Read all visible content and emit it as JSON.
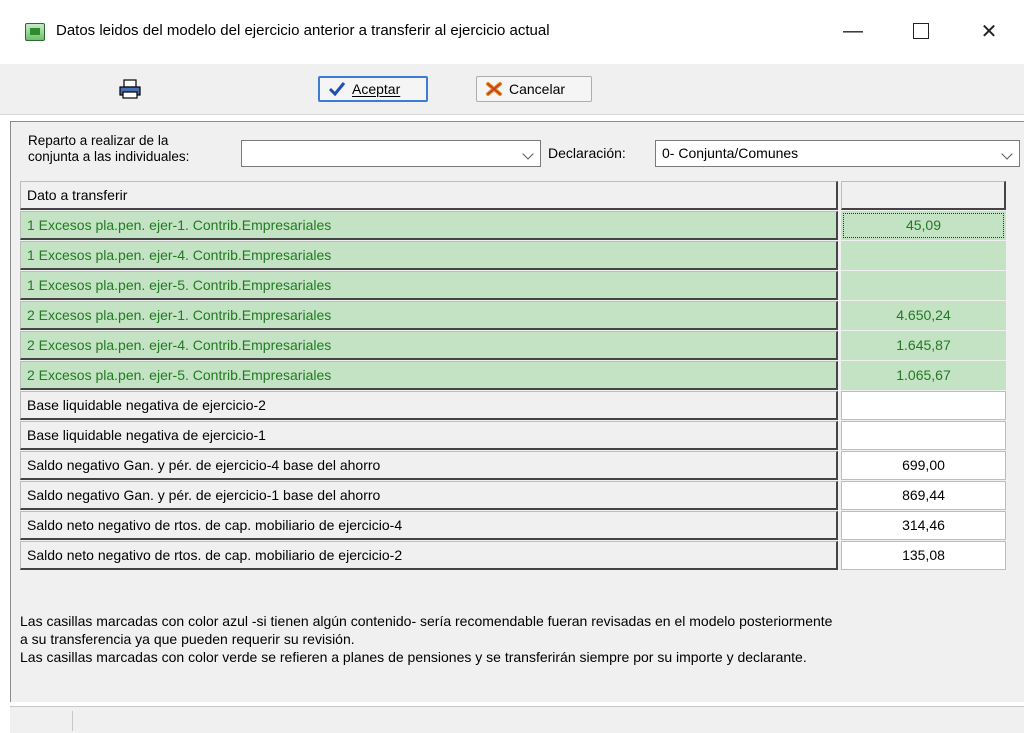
{
  "window": {
    "title": "Datos leidos del modelo del ejercicio anterior a transferir al ejercicio actual",
    "minimize": "—",
    "close": "✕"
  },
  "toolbar": {
    "accept_label": "Aceptar",
    "cancel_label": "Cancelar"
  },
  "form": {
    "reparto_label_line1": "Reparto a realizar de la",
    "reparto_label_line2": "conjunta a las individuales:",
    "reparto_value": "",
    "declaracion_label": "Declaración:",
    "declaracion_value": "0- Conjunta/Comunes"
  },
  "grid": {
    "header_label": "Dato a transferir",
    "header_value": "",
    "rows": [
      {
        "label": "1 Excesos pla.pen. ejer-1. Contrib.Empresariales",
        "value": "45,09"
      },
      {
        "label": "1 Excesos pla.pen. ejer-4. Contrib.Empresariales",
        "value": ""
      },
      {
        "label": "1 Excesos pla.pen. ejer-5. Contrib.Empresariales",
        "value": ""
      },
      {
        "label": "2 Excesos pla.pen. ejer-1. Contrib.Empresariales",
        "value": "4.650,24"
      },
      {
        "label": "2 Excesos pla.pen. ejer-4. Contrib.Empresariales",
        "value": "1.645,87"
      },
      {
        "label": "2 Excesos pla.pen. ejer-5. Contrib.Empresariales",
        "value": "1.065,67"
      },
      {
        "label": "Base liquidable negativa de ejercicio-2",
        "value": ""
      },
      {
        "label": "Base liquidable negativa de ejercicio-1",
        "value": ""
      },
      {
        "label": "Saldo negativo Gan. y pér. de ejercicio-4 base del ahorro",
        "value": "699,00"
      },
      {
        "label": "Saldo negativo Gan. y pér. de ejercicio-1 base del ahorro",
        "value": "869,44"
      },
      {
        "label": "Saldo neto negativo de rtos. de cap. mobiliario de ejercicio-4",
        "value": "314,46"
      },
      {
        "label": "Saldo neto negativo de rtos. de cap. mobiliario de ejercicio-2",
        "value": "135,08"
      }
    ]
  },
  "notes": {
    "line1": "Las casillas marcadas con color azul -si tienen algún contenido- sería recomendable fueran revisadas en el modelo posteriormente",
    "line2": "a su transferencia ya que pueden requerir su revisión.",
    "line3": "Las casillas marcadas con color verde se refieren a planes de pensiones y se transferirán siempre por su importe y declarante."
  },
  "colors": {
    "green_bg": "#c4e2c4",
    "green_text": "#217a21",
    "accent": "#3d7bd9"
  }
}
